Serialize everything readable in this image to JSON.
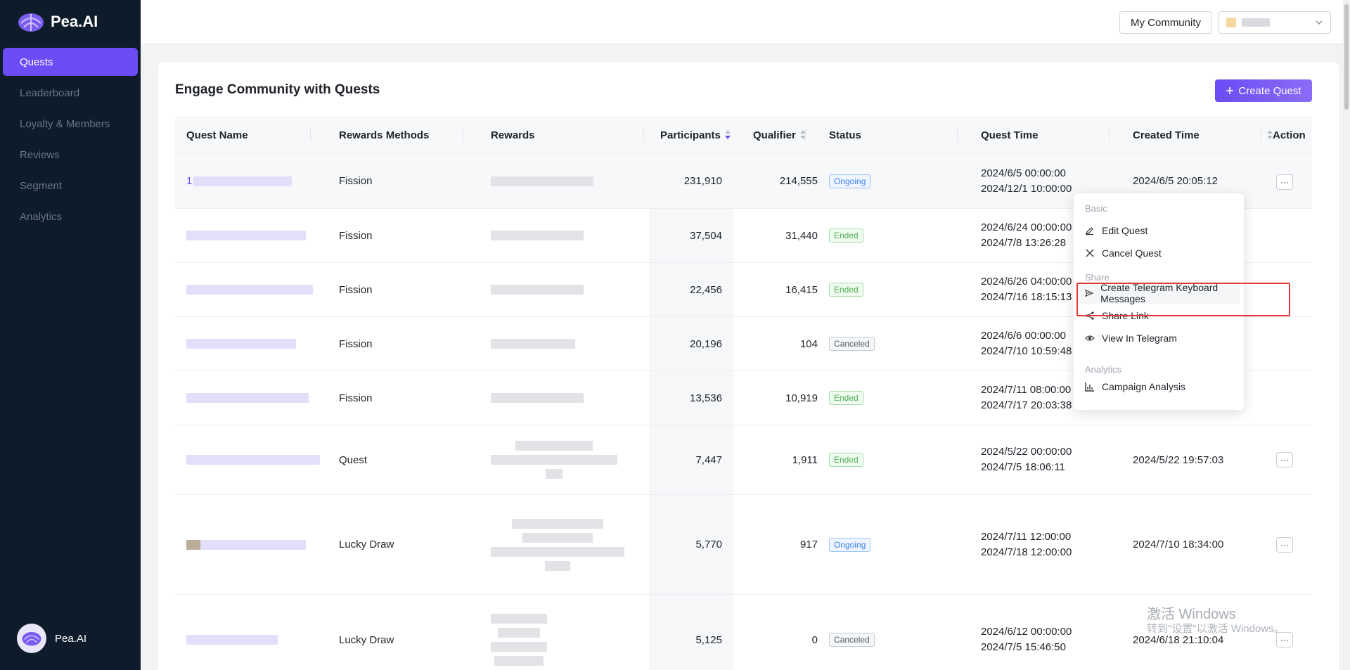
{
  "brand": {
    "name": "Pea.AI"
  },
  "sidebar": {
    "items": [
      {
        "label": "Quests",
        "active": true
      },
      {
        "label": "Leaderboard",
        "active": false
      },
      {
        "label": "Loyalty & Members",
        "active": false
      },
      {
        "label": "Reviews",
        "active": false
      },
      {
        "label": "Segment",
        "active": false
      },
      {
        "label": "Analytics",
        "active": false
      }
    ],
    "user_name": "Pea.AI"
  },
  "header": {
    "community_button": "My Community"
  },
  "main": {
    "title": "Engage Community with Quests",
    "create_button": "Create Quest"
  },
  "table": {
    "columns": [
      "Quest Name",
      "Rewards Methods",
      "Rewards",
      "Participants",
      "Qualifier",
      "Status",
      "Quest Time",
      "Created Time",
      "Action"
    ],
    "rows": [
      {
        "name_prefix": "1",
        "method": "Fission",
        "participants": "231,910",
        "qualifier": "214,555",
        "status": "Ongoing",
        "time_start": "2024/6/5 00:00:00",
        "time_end": "2024/12/1 10:00:00",
        "created": "2024/6/5 20:05:12"
      },
      {
        "name_prefix": "",
        "method": "Fission",
        "participants": "37,504",
        "qualifier": "31,440",
        "status": "Ended",
        "time_start": "2024/6/24 00:00:00",
        "time_end": "2024/7/8 13:26:28",
        "created": ""
      },
      {
        "name_prefix": "",
        "method": "Fission",
        "participants": "22,456",
        "qualifier": "16,415",
        "status": "Ended",
        "time_start": "2024/6/26 04:00:00",
        "time_end": "2024/7/16 18:15:13",
        "created": ""
      },
      {
        "name_prefix": "",
        "method": "Fission",
        "participants": "20,196",
        "qualifier": "104",
        "status": "Canceled",
        "time_start": "2024/6/6 00:00:00",
        "time_end": "2024/7/10 10:59:48",
        "created": ""
      },
      {
        "name_prefix": "",
        "method": "Fission",
        "participants": "13,536",
        "qualifier": "10,919",
        "status": "Ended",
        "time_start": "2024/7/11 08:00:00",
        "time_end": "2024/7/17 20:03:38",
        "created": ""
      },
      {
        "name_prefix": "",
        "method": "Quest",
        "participants": "7,447",
        "qualifier": "1,911",
        "status": "Ended",
        "time_start": "2024/5/22 00:00:00",
        "time_end": "2024/7/5 18:06:11",
        "created": "2024/5/22 19:57:03"
      },
      {
        "name_prefix": "",
        "method": "Lucky Draw",
        "participants": "5,770",
        "qualifier": "917",
        "status": "Ongoing",
        "time_start": "2024/7/11 12:00:00",
        "time_end": "2024/7/18 12:00:00",
        "created": "2024/7/10 18:34:00"
      },
      {
        "name_prefix": "",
        "method": "Lucky Draw",
        "participants": "5,125",
        "qualifier": "0",
        "status": "Canceled",
        "time_start": "2024/6/12 00:00:00",
        "time_end": "2024/7/5 15:46:50",
        "created": "2024/6/18 21:10:04"
      }
    ],
    "action_label": "···"
  },
  "menu": {
    "group_basic": "Basic",
    "edit": "Edit Quest",
    "cancel": "Cancel Quest",
    "group_share": "Share",
    "telegram_kb": "Create Telegram Keyboard Messages",
    "share_link": "Share Link",
    "view_tg": "View In Telegram",
    "group_analytics": "Analytics",
    "campaign": "Campaign Analysis"
  },
  "watermark": {
    "line1": "激活 Windows",
    "line2": "转到\"设置\"以激活 Windows。"
  },
  "colors": {
    "accent": "#6c4cf5",
    "sidebar_bg": "#0d1b2a",
    "highlight_box": "#e53935"
  }
}
